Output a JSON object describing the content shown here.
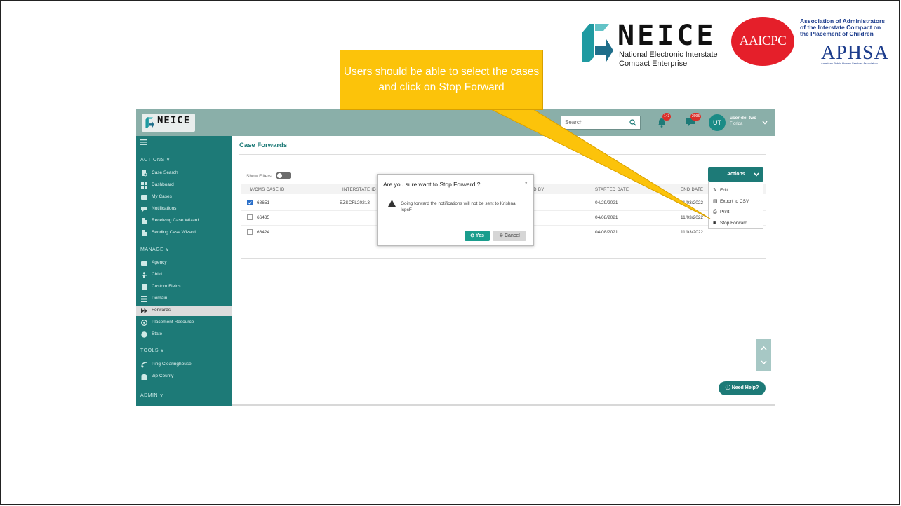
{
  "slide": {
    "callout_text": "Users should be able to select the cases and click on Stop Forward"
  },
  "logos": {
    "neice": {
      "word": "NEICE",
      "sub_line1": "National Electronic Interstate",
      "sub_line2": "Compact Enterprise"
    },
    "aaicpc": {
      "word": "AAICPC",
      "text_lines": [
        "Association of Administrators",
        "of the Interstate Compact on",
        "the Placement of Children"
      ]
    },
    "aphsa": {
      "word": "APHSA",
      "sub": "American Public Human Services Association"
    }
  },
  "app": {
    "header": {
      "logo_word": "NEICE",
      "search_placeholder": "Search",
      "bell_badge": "143",
      "chat_badge": "2095",
      "avatar_initials": "UT",
      "user_name": "user-del two",
      "user_state": "Florida"
    },
    "sidebar": {
      "sections": [
        {
          "label": "ACTIONS ∨",
          "items": [
            "Case Search",
            "Dashboard",
            "My Cases",
            "Notifications",
            "Receiving Case Wizard",
            "Sending Case Wizard"
          ]
        },
        {
          "label": "MANAGE ∨",
          "items": [
            "Agency",
            "Child",
            "Custom Fields",
            "Domain",
            "Forwards",
            "Placement Resource",
            "State"
          ]
        },
        {
          "label": "TOOLS ∨",
          "items": [
            "Ping Clearinghouse",
            "Zip County"
          ]
        },
        {
          "label": "ADMIN ∨",
          "items": []
        }
      ],
      "active_item": "Forwards"
    },
    "page_title": "Case Forwards",
    "show_filters_label": "Show Filters",
    "actions_button": "Actions",
    "actions_menu": [
      "Edit",
      "Export to CSV",
      "Print",
      "Stop Forward"
    ],
    "table": {
      "headers": [
        "M/CMS CASE ID",
        "INTERSTATE ID",
        "ED BY",
        "STARTED DATE",
        "END DATE"
      ],
      "rows": [
        {
          "checked": true,
          "case_id": "68651",
          "interstate_id": "BZSCFL20213",
          "started": "04/29/2021",
          "end": "11/03/2022"
        },
        {
          "checked": false,
          "case_id": "66435",
          "interstate_id": "",
          "started": "04/08/2021",
          "end": "11/03/2022"
        },
        {
          "checked": false,
          "case_id": "66424",
          "interstate_id": "",
          "started": "04/08/2021",
          "end": "11/03/2022"
        }
      ]
    },
    "modal": {
      "title": "Are you sure want to Stop Forward ?",
      "close": "×",
      "message": "Going forward the notifications will not be sent to Krishna IcpcF",
      "yes": "Yes",
      "cancel": "Cancel"
    },
    "help_button": "Need Help?"
  },
  "colors": {
    "teal": "#1d7a77",
    "topbar": "#8aafa9",
    "callout": "#fcc30a",
    "aaicpc_red": "#e51f2a",
    "aphsa_blue": "#1c3c8c"
  }
}
